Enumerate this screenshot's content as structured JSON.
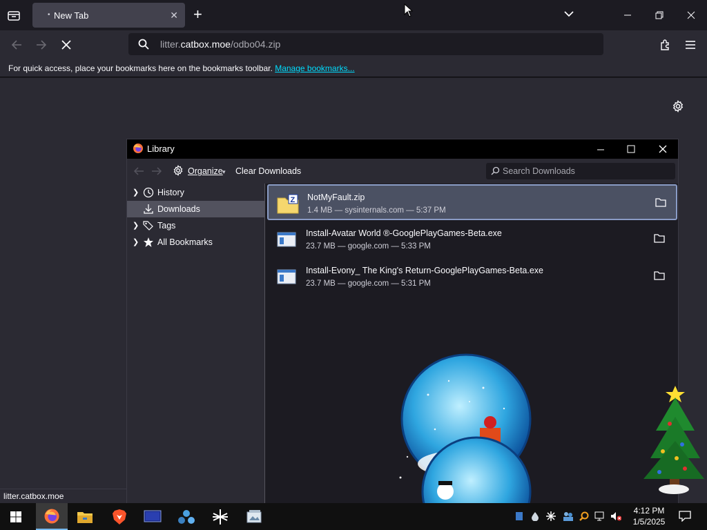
{
  "browser": {
    "tab": {
      "title": "New Tab"
    },
    "url": {
      "prefix": "litter.",
      "domain": "catbox.moe",
      "path": "/odbo04.zip"
    },
    "bookmarks_bar": {
      "message": "For quick access, place your bookmarks here on the bookmarks toolbar.",
      "link": "Manage bookmarks..."
    },
    "status_url": "litter.catbox.moe"
  },
  "library": {
    "title": "Library",
    "toolbar": {
      "organize": "Organize",
      "clear_downloads": "Clear Downloads",
      "search_placeholder": "Search Downloads"
    },
    "sidebar": [
      {
        "label": "History",
        "icon": "clock-icon",
        "expandable": true
      },
      {
        "label": "Downloads",
        "icon": "download-icon",
        "expandable": false,
        "selected": true
      },
      {
        "label": "Tags",
        "icon": "tags-icon",
        "expandable": true
      },
      {
        "label": "All Bookmarks",
        "icon": "star-icon",
        "expandable": true
      }
    ],
    "downloads": [
      {
        "name": "NotMyFault.zip",
        "meta": "1.4 MB — sysinternals.com — 5:37 PM",
        "icon": "zip-folder-icon",
        "selected": true
      },
      {
        "name": "Install-Avatar World ®-GooglePlayGames-Beta.exe",
        "meta": "23.7 MB — google.com — 5:33 PM",
        "icon": "exe-installer-icon"
      },
      {
        "name": "Install-Evony_ The King's Return-GooglePlayGames-Beta.exe",
        "meta": "23.7 MB — google.com — 5:31 PM",
        "icon": "exe-installer-icon"
      }
    ]
  },
  "taskbar": {
    "apps": [
      "start-icon",
      "firefox-icon",
      "file-explorer-icon",
      "brave-icon",
      "monitor-app-icon",
      "network-app-icon",
      "asterisk-app-icon",
      "photos-app-icon"
    ],
    "clock": {
      "time": "4:12 PM",
      "date": "1/5/2025"
    }
  },
  "colors": {
    "accent_link": "#00ddff",
    "selected_row": "#4b5163",
    "taskbar_active": "#76b9ed"
  }
}
